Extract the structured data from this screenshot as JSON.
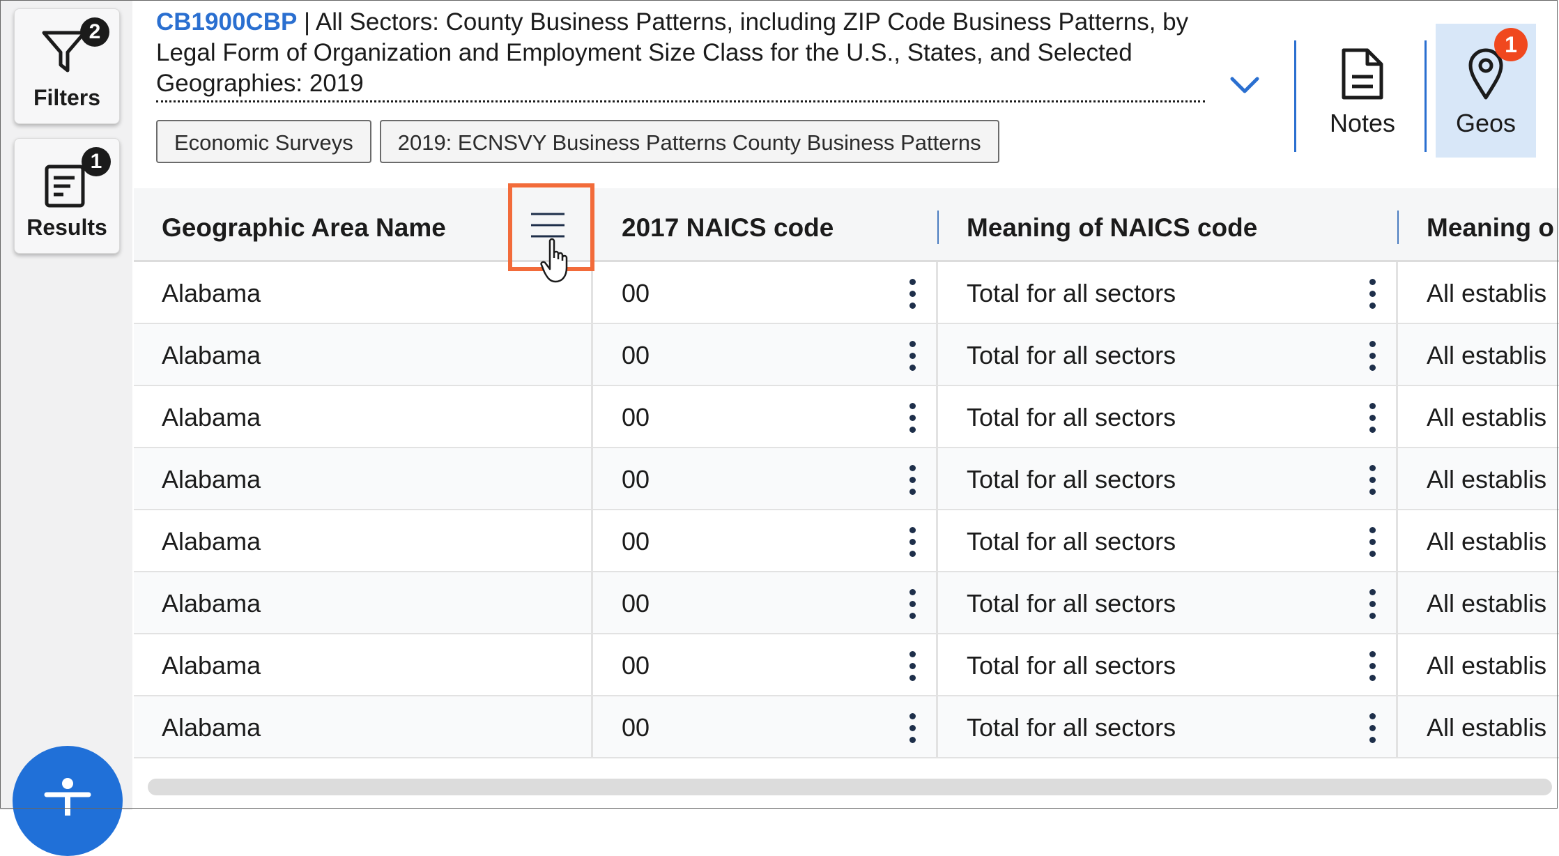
{
  "rail": {
    "filters": {
      "label": "Filters",
      "badge": "2",
      "icon": "funnel-icon"
    },
    "results": {
      "label": "Results",
      "badge": "1",
      "icon": "list-doc-icon"
    },
    "accessibility": {
      "icon": "accessibility-icon"
    }
  },
  "header": {
    "code": "CB1900CBP",
    "separator": " | ",
    "title": "All Sectors: County Business Patterns, including ZIP Code Business Patterns, by Legal Form of Organization and Employment Size Class for the U.S., States, and Selected Geographies: 2019",
    "breadcrumbs": [
      "Economic Surveys",
      "2019: ECNSVY Business Patterns County Business Patterns"
    ],
    "tools": [
      {
        "label": "Notes",
        "icon": "document-icon"
      },
      {
        "label": "Geos",
        "icon": "map-pin-icon",
        "badge": "1"
      }
    ]
  },
  "table": {
    "columns": [
      "Geographic Area Name",
      "2017 NAICS code",
      "Meaning of NAICS code",
      "Meaning o"
    ],
    "rows": [
      [
        "Alabama",
        "00",
        "Total for all sectors",
        "All establis"
      ],
      [
        "Alabama",
        "00",
        "Total for all sectors",
        "All establis"
      ],
      [
        "Alabama",
        "00",
        "Total for all sectors",
        "All establis"
      ],
      [
        "Alabama",
        "00",
        "Total for all sectors",
        "All establis"
      ],
      [
        "Alabama",
        "00",
        "Total for all sectors",
        "All establis"
      ],
      [
        "Alabama",
        "00",
        "Total for all sectors",
        "All establis"
      ],
      [
        "Alabama",
        "00",
        "Total for all sectors",
        "All establis"
      ],
      [
        "Alabama",
        "00",
        "Total for all sectors",
        "All establis"
      ]
    ]
  },
  "colors": {
    "accent": "#2a6fd0",
    "highlight": "#f26b3a",
    "badge_red": "#f0481e",
    "geos_active_bg": "#d8e7f8"
  }
}
